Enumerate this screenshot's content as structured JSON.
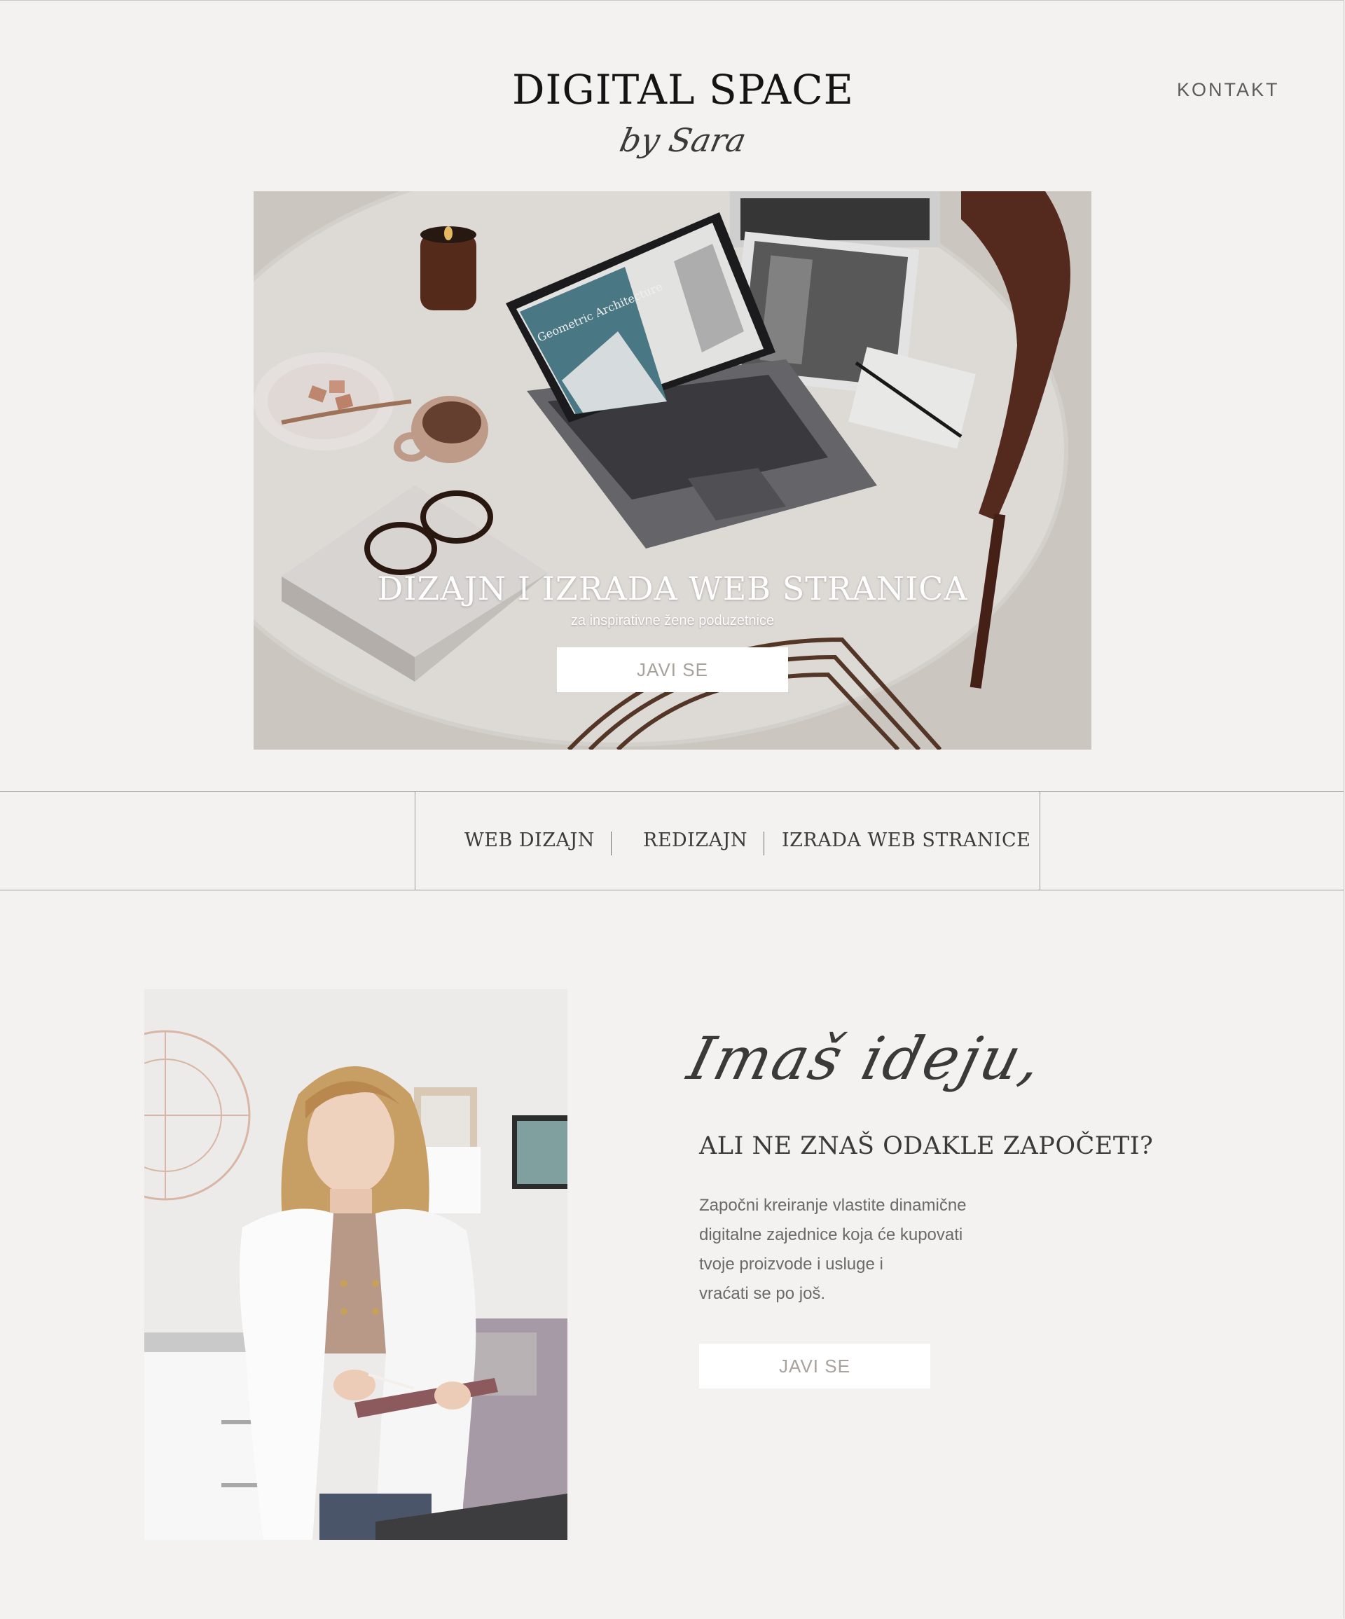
{
  "header": {
    "brand_title": "DIGITAL SPACE",
    "brand_subtitle": "by Sara",
    "nav_contact": "KONTAKT"
  },
  "hero": {
    "title": "DIZAJN I IZRADA WEB STRANICA",
    "subtitle": "za inspirativne žene poduzetnice",
    "button_label": "JAVI SE",
    "laptop_screen_text": "Geometric Architecture"
  },
  "services": {
    "items": [
      "WEB DIZAJN",
      "REDIZAJN",
      "IZRADA WEB STRANICE"
    ]
  },
  "about": {
    "script_heading": "Imaš ideju,",
    "heading": "ALI NE ZNAŠ ODAKLE ZAPOČETI?",
    "paragraph_lines": [
      "Započni kreiranje vlastite dinamične",
      "digitalne zajednice koja će kupovati",
      "tvoje proizvode i usluge i",
      "vraćati se po još."
    ],
    "button_label": "JAVI SE"
  },
  "colors": {
    "page_background": "#f4f2f0",
    "button_background": "#ffffff",
    "button_text": "#a9a29c",
    "divider": "#9c9c9c"
  }
}
